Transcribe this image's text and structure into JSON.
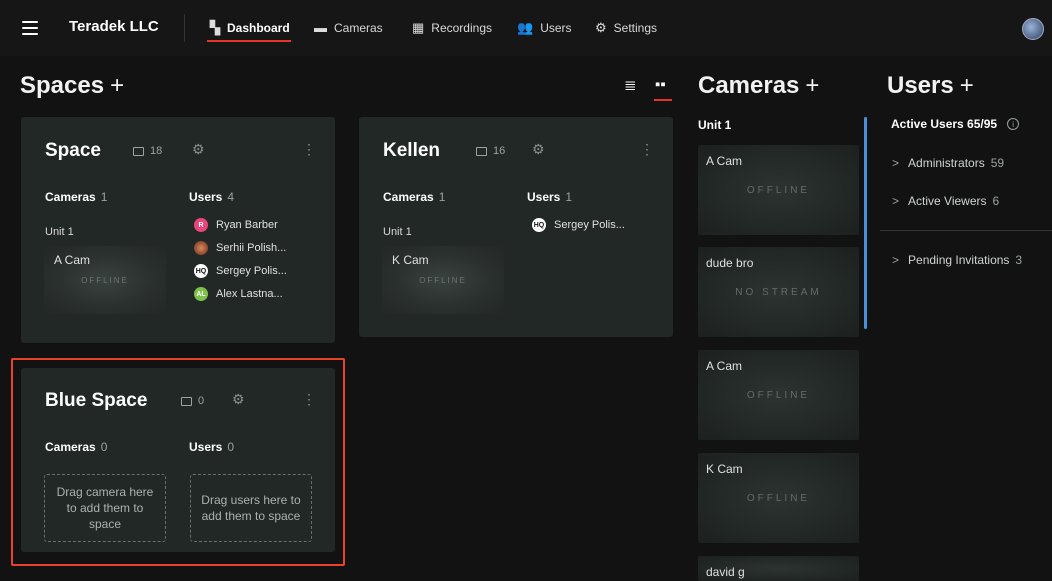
{
  "nav": {
    "brand": "Teradek LLC",
    "items": [
      {
        "label": "Dashboard",
        "icon": "dashboard-icon"
      },
      {
        "label": "Cameras",
        "icon": "camera-icon"
      },
      {
        "label": "Recordings",
        "icon": "recordings-icon"
      },
      {
        "label": "Users",
        "icon": "users-icon"
      },
      {
        "label": "Settings",
        "icon": "gear-icon"
      }
    ],
    "active": "Dashboard"
  },
  "spaces": {
    "title": "Spaces",
    "add": "+",
    "cards": [
      {
        "name": "Space",
        "count": "18",
        "cameras_label": "Cameras",
        "cameras_count": "1",
        "users_label": "Users",
        "users_count": "4",
        "unit": "Unit 1",
        "camera": {
          "name": "A Cam",
          "status": "OFFLINE"
        },
        "users": [
          {
            "initials": "R",
            "name": "Ryan Barber",
            "color": "#e8467a"
          },
          {
            "initials": "",
            "name": "Serhii Polish...",
            "color": "#b0563a"
          },
          {
            "initials": "HQ",
            "name": "Sergey Polis...",
            "color": "#ffffff"
          },
          {
            "initials": "AL",
            "name": "Alex Lastna...",
            "color": "#7cc04b"
          }
        ]
      },
      {
        "name": "Kellen",
        "count": "16",
        "cameras_label": "Cameras",
        "cameras_count": "1",
        "users_label": "Users",
        "users_count": "1",
        "unit": "Unit 1",
        "camera": {
          "name": "K Cam",
          "status": "OFFLINE"
        },
        "users": [
          {
            "initials": "HQ",
            "name": "Sergey Polis...",
            "color": "#ffffff"
          }
        ]
      },
      {
        "name": "Blue Space",
        "count": "0",
        "cameras_label": "Cameras",
        "cameras_count": "0",
        "users_label": "Users",
        "users_count": "0",
        "drop_cameras": "Drag camera here to add them to space",
        "drop_users": "Drag users here to add them to space"
      }
    ]
  },
  "cameras": {
    "title": "Cameras",
    "add": "+",
    "group": "Unit 1",
    "tiles": [
      {
        "name": "A Cam",
        "status": "OFFLINE"
      },
      {
        "name": "dude bro",
        "status": "NO STREAM"
      },
      {
        "name": "A Cam",
        "status": "OFFLINE"
      },
      {
        "name": "K Cam",
        "status": "OFFLINE"
      },
      {
        "name": "david g",
        "status": ""
      }
    ]
  },
  "users": {
    "title": "Users",
    "add": "+",
    "active_label": "Active Users 65/95",
    "groups": [
      {
        "label": "Administrators",
        "count": "59"
      },
      {
        "label": "Active Viewers",
        "count": "6"
      },
      {
        "label": "Pending Invitations",
        "count": "3"
      }
    ]
  },
  "colors": {
    "accent": "#e8332a",
    "scroll": "#4a8fd8",
    "card": "#222826"
  }
}
